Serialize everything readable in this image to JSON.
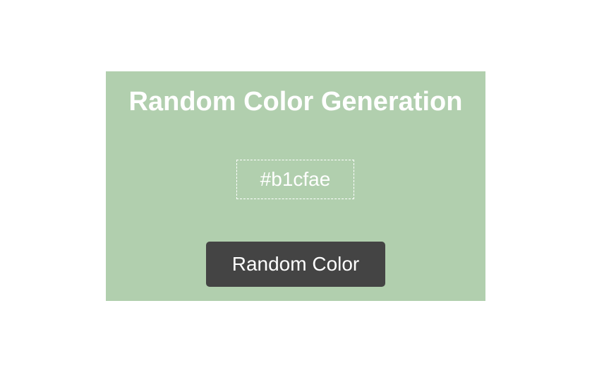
{
  "card": {
    "title": "Random Color Generation",
    "background_color": "#b1cfae"
  },
  "color_display": {
    "value": "#b1cfae"
  },
  "button": {
    "label": "Random Color",
    "background_color": "#444444"
  }
}
